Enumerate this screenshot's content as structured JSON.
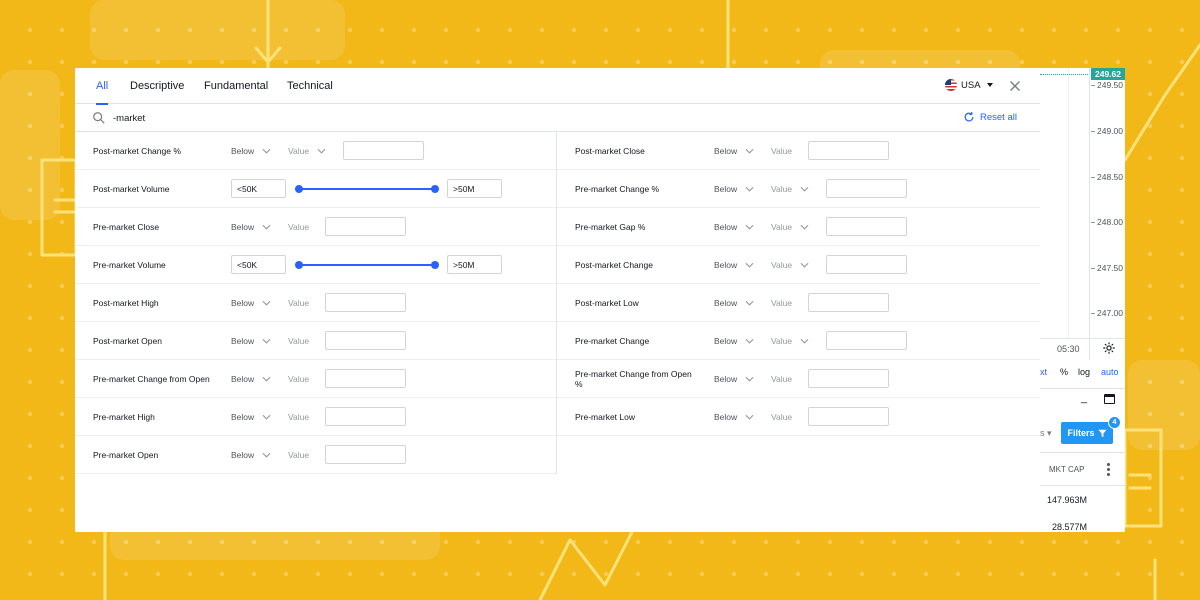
{
  "panel": {
    "tabs": [
      "All",
      "Descriptive",
      "Fundamental",
      "Technical"
    ],
    "active_tab": "All",
    "country": "USA",
    "search_value": "-market",
    "reset_label": "Reset all"
  },
  "filters_left": [
    {
      "name": "Post-market Change %",
      "op": "Below",
      "value_label": "Value",
      "kind": "value",
      "value_dropdown": true
    },
    {
      "name": "Post-market Volume",
      "kind": "range",
      "min": "<50K",
      "max": ">50M"
    },
    {
      "name": "Pre-market Close",
      "op": "Below",
      "value_label": "Value",
      "kind": "value",
      "value_dropdown": false
    },
    {
      "name": "Pre-market Volume",
      "kind": "range",
      "min": "<50K",
      "max": ">50M"
    },
    {
      "name": "Post-market High",
      "op": "Below",
      "value_label": "Value",
      "kind": "value",
      "value_dropdown": false
    },
    {
      "name": "Post-market Open",
      "op": "Below",
      "value_label": "Value",
      "kind": "value",
      "value_dropdown": false
    },
    {
      "name": "Pre-market Change from Open",
      "op": "Below",
      "value_label": "Value",
      "kind": "value",
      "value_dropdown": false
    },
    {
      "name": "Pre-market High",
      "op": "Below",
      "value_label": "Value",
      "kind": "value",
      "value_dropdown": false
    },
    {
      "name": "Pre-market Open",
      "op": "Below",
      "value_label": "Value",
      "kind": "value",
      "value_dropdown": false
    }
  ],
  "filters_right": [
    {
      "name": "Post-market Close",
      "op": "Below",
      "value_label": "Value",
      "value_dropdown": false
    },
    {
      "name": "Pre-market Change %",
      "op": "Below",
      "value_label": "Value",
      "value_dropdown": true
    },
    {
      "name": "Pre-market Gap %",
      "op": "Below",
      "value_label": "Value",
      "value_dropdown": true
    },
    {
      "name": "Post-market Change",
      "op": "Below",
      "value_label": "Value",
      "value_dropdown": true
    },
    {
      "name": "Post-market Low",
      "op": "Below",
      "value_label": "Value",
      "value_dropdown": false
    },
    {
      "name": "Pre-market Change",
      "op": "Below",
      "value_label": "Value",
      "value_dropdown": true
    },
    {
      "name": "Pre-market Change from Open %",
      "op": "Below",
      "value_label": "Value",
      "value_dropdown": false
    },
    {
      "name": "Pre-market Low",
      "op": "Below",
      "value_label": "Value",
      "value_dropdown": false
    }
  ],
  "chart": {
    "last_price": "249.62",
    "price_ticks": [
      "249.50",
      "249.00",
      "248.50",
      "248.00",
      "247.50",
      "247.00"
    ],
    "time_label": "05:30",
    "scale_cut": "xt",
    "scale_percent": "%",
    "scale_log": "log",
    "scale_auto": "auto"
  },
  "screener": {
    "cut_text": "s",
    "filters_label": "Filters",
    "filters_count": "4",
    "column_label": "MKT CAP",
    "mkt_cap_values": [
      "147.963M",
      "28.577M"
    ]
  },
  "colors": {
    "accent": "#2962ff",
    "button_blue": "#2196f3",
    "price_green": "#26a69a",
    "background_yellow": "#f2b817"
  }
}
